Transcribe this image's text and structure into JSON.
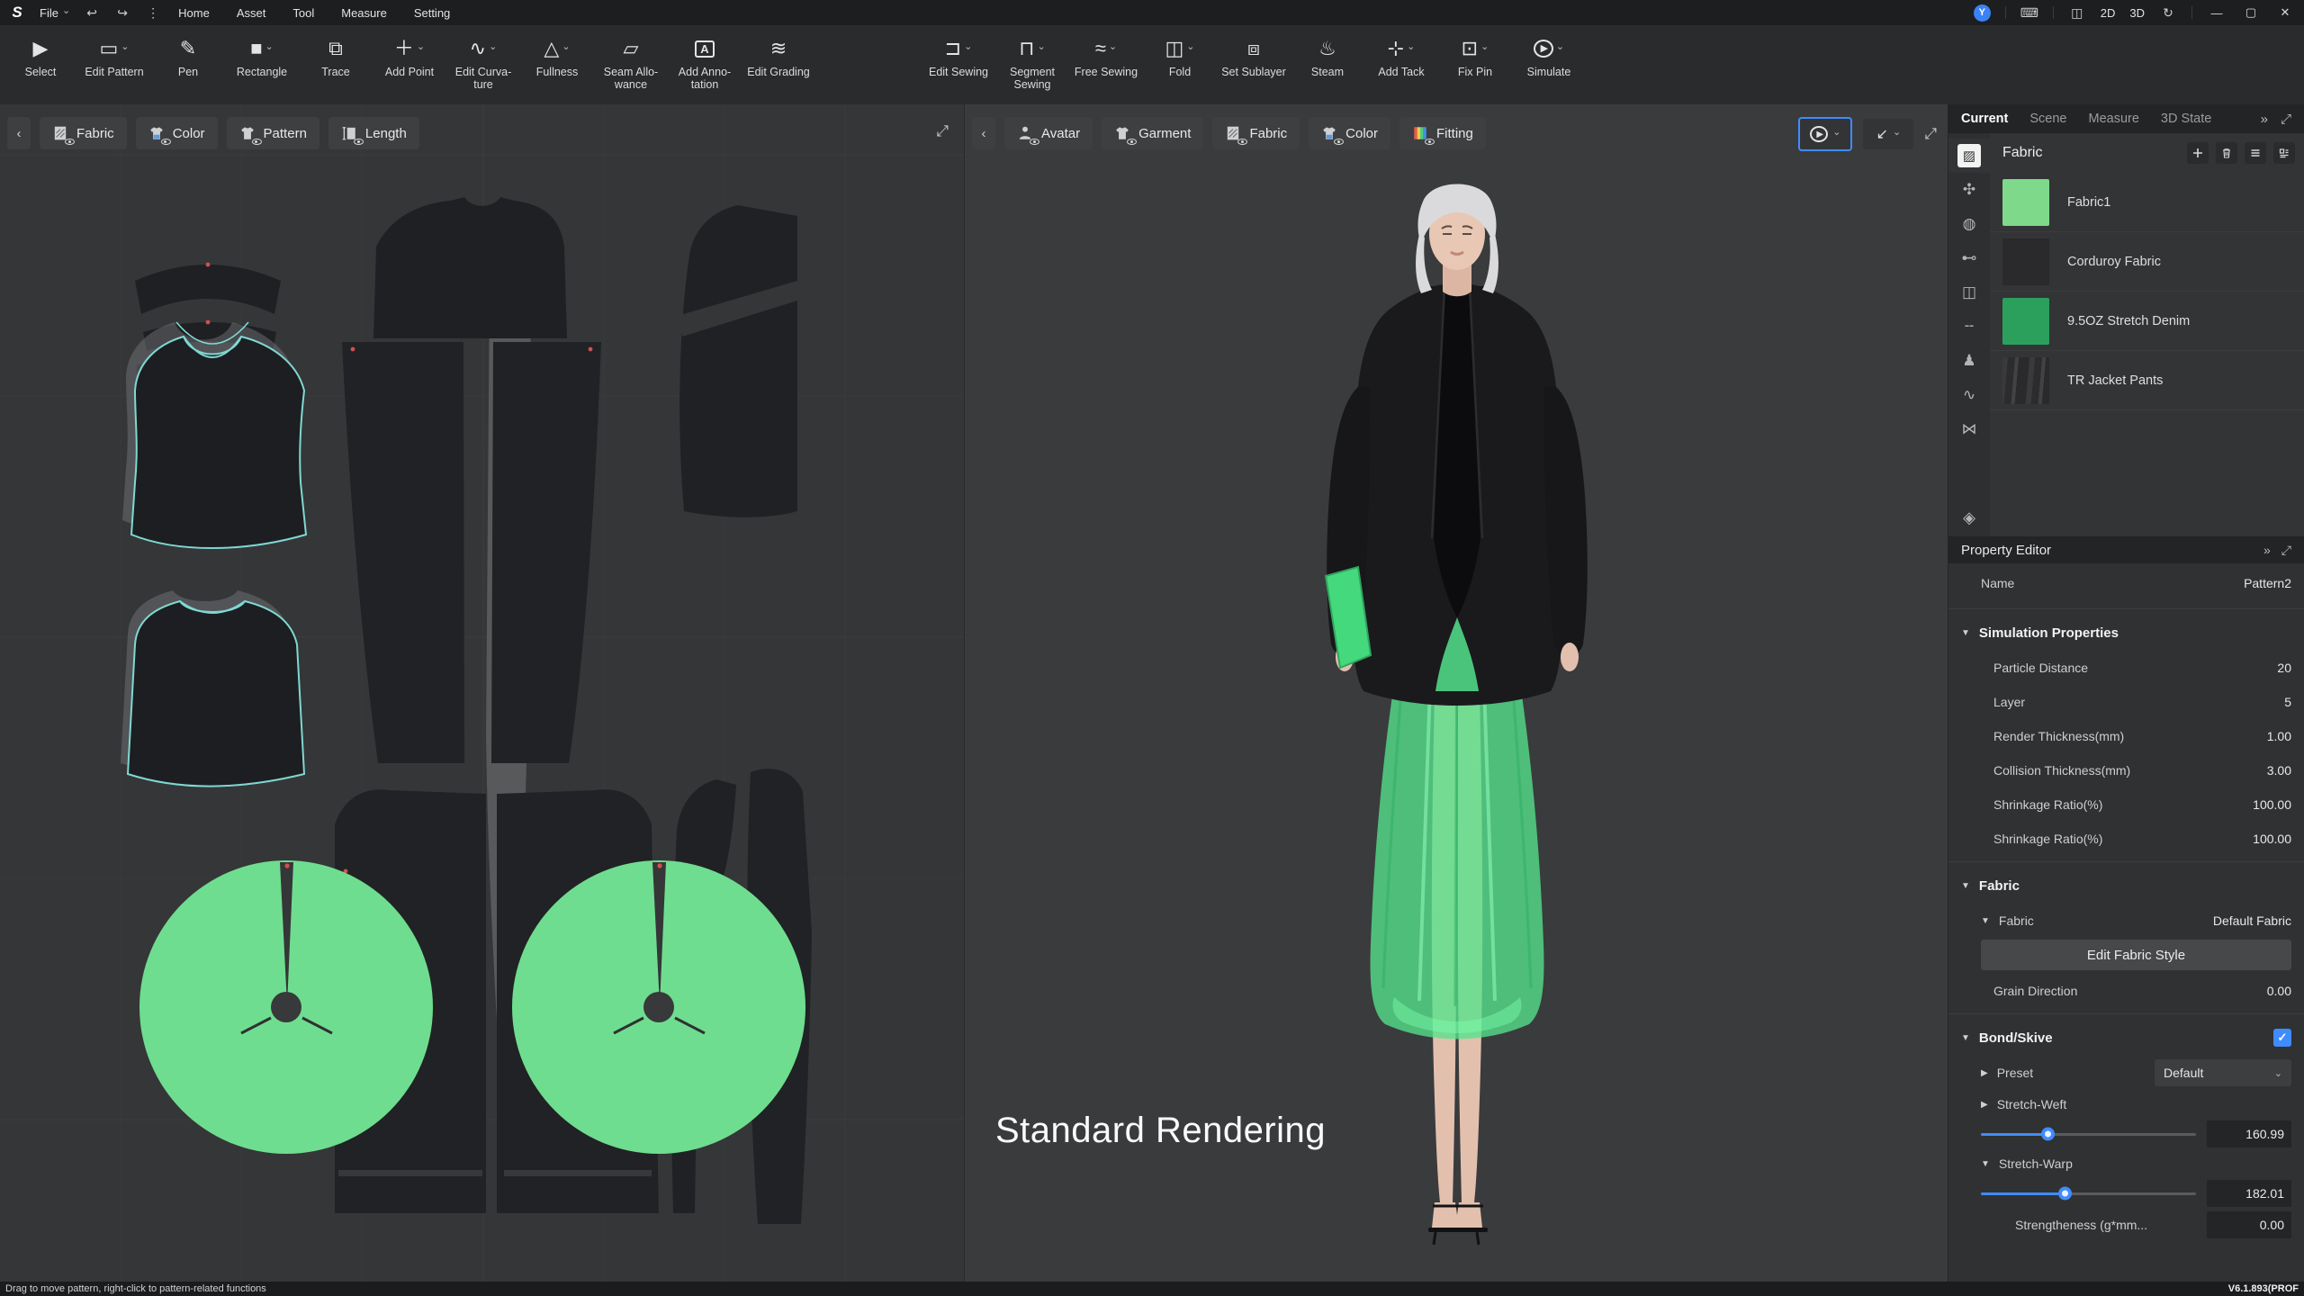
{
  "icons": {
    "chevron_down": "⌄",
    "collapse_left": "‹",
    "expand": "⤢",
    "overflow": "»",
    "undo": "↩",
    "redo": "↪",
    "kebab": "⋮",
    "minimize": "—",
    "maximize": "▢",
    "close": "✕",
    "keyboard": "⌨",
    "split_view": "◫",
    "sync": "↻",
    "check": "✓"
  },
  "titlebar": {
    "logo_text": "S",
    "file_label": "File",
    "menus": [
      "Home",
      "Asset",
      "Tool",
      "Measure",
      "Setting"
    ],
    "avatar_initial": "Y",
    "view_2d": "2D",
    "view_3d": "3D"
  },
  "toolbar": {
    "tools": [
      {
        "label": "Select",
        "glyph": "▶"
      },
      {
        "label": "Edit Pattern",
        "glyph": "▭"
      },
      {
        "label": "Pen",
        "glyph": "✎"
      },
      {
        "label": "Rectangle",
        "glyph": "■"
      },
      {
        "label": "Trace",
        "glyph": "⧉"
      },
      {
        "label": "Add Point",
        "glyph": "＋"
      },
      {
        "label": "Edit Curva-ture",
        "glyph": "∿"
      },
      {
        "label": "Fullness",
        "glyph": "△"
      },
      {
        "label": "Seam Allo-wance",
        "glyph": "▱"
      },
      {
        "label": "Add Anno-tation",
        "glyph": "A"
      },
      {
        "label": "Edit Grading",
        "glyph": "≋"
      },
      {
        "label": "Edit Sewing",
        "glyph": "⊐"
      },
      {
        "label": "Segment Sewing",
        "glyph": "⊓"
      },
      {
        "label": "Free Sewing",
        "glyph": "≈"
      },
      {
        "label": "Fold",
        "glyph": "◫"
      },
      {
        "label": "Set Sublayer",
        "glyph": "⧈"
      },
      {
        "label": "Steam",
        "glyph": "♨"
      },
      {
        "label": "Add Tack",
        "glyph": "⊹"
      },
      {
        "label": "Fix Pin",
        "glyph": "⊡"
      },
      {
        "label": "Simulate",
        "glyph": "▶"
      }
    ]
  },
  "pattern_panel": {
    "tabs": [
      "Fabric",
      "Color",
      "Pattern",
      "Length"
    ]
  },
  "viewport": {
    "tabs": [
      "Avatar",
      "Garment",
      "Fabric",
      "Color",
      "Fitting"
    ],
    "overlay_label": "Standard Rendering"
  },
  "right_panel": {
    "tabs": [
      "Current",
      "Scene",
      "Measure",
      "3D State"
    ],
    "fabric_browser": {
      "title": "Fabric",
      "items": [
        {
          "name": "Fabric1",
          "swatch_color": "#7ed98b"
        },
        {
          "name": "Corduroy Fabric",
          "swatch_color": "#2a2a2c"
        },
        {
          "name": "9.5OZ Stretch Denim",
          "swatch_color": "#2ba05c"
        },
        {
          "name": "TR Jacket Pants",
          "swatch_color": "#39383a"
        }
      ]
    },
    "rail": [
      {
        "name": "fabric",
        "glyph": "▨"
      },
      {
        "name": "trim",
        "glyph": "✣"
      },
      {
        "name": "button",
        "glyph": "◍"
      },
      {
        "name": "tack",
        "glyph": "⊷"
      },
      {
        "name": "zipper",
        "glyph": "◫"
      },
      {
        "name": "topstitch",
        "glyph": "╌"
      },
      {
        "name": "avatar",
        "glyph": "♟"
      },
      {
        "name": "shirring",
        "glyph": "∿"
      },
      {
        "name": "puckering",
        "glyph": "⋈"
      }
    ],
    "rail_bottom_glyph": "◈",
    "property_editor": {
      "title": "Property Editor",
      "name_label": "Name",
      "name_value": "Pattern2",
      "simulation": {
        "title": "Simulation Properties",
        "rows": [
          {
            "label": "Particle Distance",
            "value": "20"
          },
          {
            "label": "Layer",
            "value": "5"
          },
          {
            "label": "Render Thickness(mm)",
            "value": "1.00"
          },
          {
            "label": "Collision Thickness(mm)",
            "value": "3.00"
          },
          {
            "label": "Shrinkage Ratio(%)",
            "value": "100.00"
          },
          {
            "label": "Shrinkage Ratio(%)",
            "value": "100.00"
          }
        ]
      },
      "fabric": {
        "title": "Fabric",
        "fabric_label": "Fabric",
        "fabric_value": "Default Fabric",
        "edit_button": "Edit  Fabric Style",
        "grain_label": "Grain Direction",
        "grain_value": "0.00"
      },
      "bond": {
        "title": "Bond/Skive",
        "preset_label": "Preset",
        "preset_value": "Default",
        "weft_label": "Stretch-Weft",
        "weft_value": "160.99",
        "weft_pos": "31%",
        "warp_label": "Stretch-Warp",
        "warp_value": "182.01",
        "warp_pos": "39%",
        "strength_label": "Strengtheness (g*mm...",
        "strength_value": "0.00"
      }
    },
    "version": "V6.1.893(PROF"
  },
  "statusbar": {
    "hint": "Drag to move pattern, right-click to pattern-related functions"
  }
}
